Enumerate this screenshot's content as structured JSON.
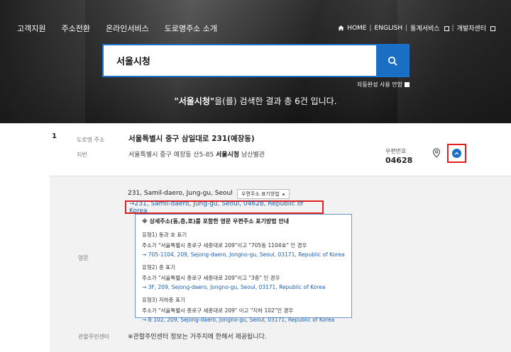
{
  "nav": {
    "left": [
      "고객지원",
      "주소전환",
      "온라인서비스",
      "도로명주소 소개"
    ],
    "home": "HOME",
    "english": "ENGLISH",
    "stats": "통계서비스",
    "dev": "개발자센터"
  },
  "search": {
    "value": "서울시청",
    "autocomplete_label": "자동완성 사용 안함"
  },
  "summary": {
    "keyword": "\"서울시청\"",
    "suffix": "을(를) 검색한 결과 총 6건 입니다."
  },
  "result": {
    "index": "1",
    "road_label": "도로명 주소",
    "road_address": "서울특별시 중구 삼일대로 231(예장동)",
    "jibun_label": "지번",
    "jibun_prefix": "서울특별시 중구 예장동 산5-85 ",
    "jibun_highlight": "서울시청",
    "jibun_suffix": " 남산별관",
    "zip_label": "우편번호",
    "zip": "04628"
  },
  "english": {
    "label": "영문",
    "address": "231, Samil-daero, Jung-gu, Seoul",
    "method_button": "우편주소 표기방법",
    "full_address": "→231, Samil-daero, Jung-gu, Seoul, 04628, Republic of Korea",
    "guide_title": "※ 상세주소(동,층,호)를 포함한 영문 우편주소 표기방법 안내",
    "guide_items": [
      {
        "type": "유형1) 동과 호 표기",
        "desc": "주소가 \"서울특별시 종로구 세종대로 209\"이고 \"705동 1104호\" 인 경우",
        "example": "→ 705-1104, 209, Sejong-daero, Jongno-gu, Seoul, 03171, Republic of Korea"
      },
      {
        "type": "유형2) 층 표기",
        "desc": "주소가 \"서울특별시 종로구 세종대로 209\"이고 \"3층\" 인 경우",
        "example": "→ 3F, 209, Sejong-daero, Jongno-gu, Seoul, 03171, Republic of Korea"
      },
      {
        "type": "유형3) 지하층 표기",
        "desc": "주소가 \"서울특별시 종로구 세종대로 209\" 이고 \"지하 102\"인 경우",
        "example": "→ B 102, 209, Sejong-daero, Jongno-gu, Seoul, 03171, Republic of Korea"
      }
    ]
  },
  "center": {
    "label": "관할주민센터",
    "text": "※관할주민센터 정보는 거주지에 한해서 제공됩니다."
  }
}
